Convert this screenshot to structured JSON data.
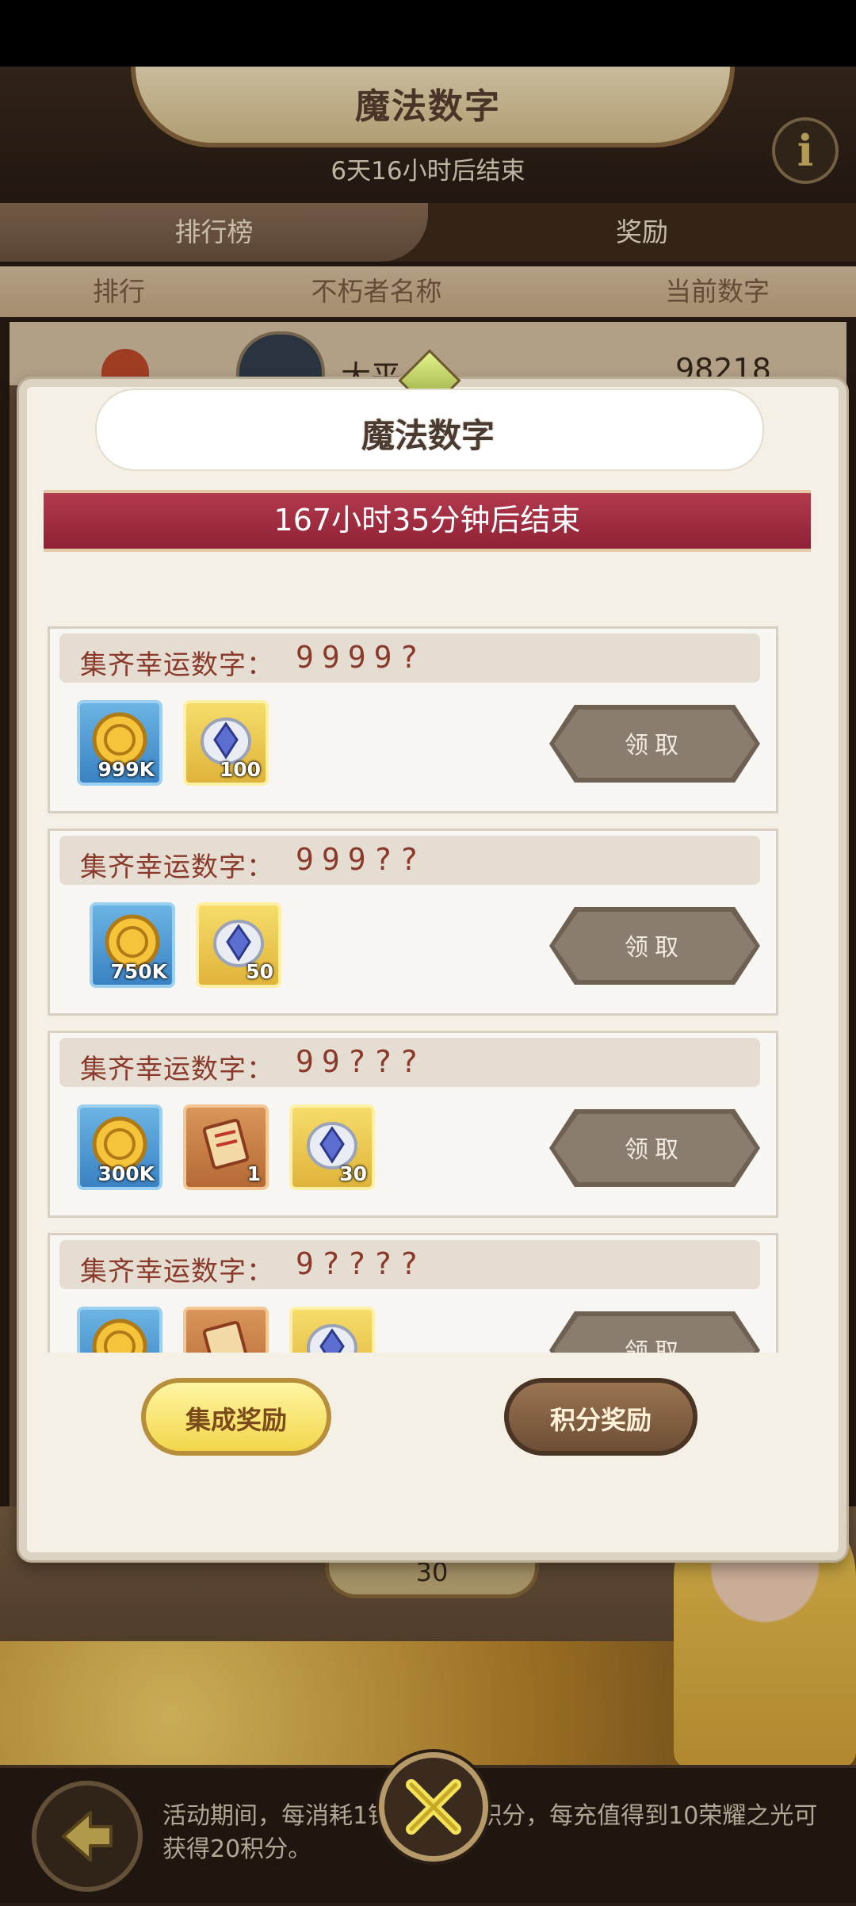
{
  "background": {
    "title": "魔法数字",
    "subtitle": "6天16小时后结束",
    "info_icon": "i",
    "tabs": [
      {
        "label": "排行榜",
        "active": true
      },
      {
        "label": "奖励",
        "active": false
      }
    ],
    "columns": [
      "排行",
      "不朽者名称",
      "当前数字"
    ],
    "row1": {
      "name": "大平",
      "score": "98218"
    },
    "counter_value": "30",
    "footer_text": "活动期间，每消耗1钻石获得1积分，每充值得到10荣耀之光可获得20积分。"
  },
  "modal": {
    "title": "魔法数字",
    "timer": "167小时35分钟后结束",
    "cards": [
      {
        "label": "集齐幸运数字：",
        "digits": "9999?",
        "rewards": [
          {
            "icon": "gold-coin-icon",
            "count": "999K",
            "frame": "blue"
          },
          {
            "icon": "crystal-stone-icon",
            "count": "100",
            "frame": "gold"
          }
        ],
        "claim_label": "领取"
      },
      {
        "label": "集齐幸运数字：",
        "digits": "999??",
        "rewards": [
          {
            "icon": "gold-coin-icon",
            "count": "750K",
            "frame": "blue"
          },
          {
            "icon": "crystal-stone-icon",
            "count": "50",
            "frame": "gold"
          }
        ],
        "claim_label": "领取"
      },
      {
        "label": "集齐幸运数字：",
        "digits": "99???",
        "rewards": [
          {
            "icon": "gold-coin-icon",
            "count": "300K",
            "frame": "blue"
          },
          {
            "icon": "scroll-icon",
            "count": "1",
            "frame": "brown"
          },
          {
            "icon": "crystal-stone-icon",
            "count": "30",
            "frame": "gold"
          }
        ],
        "claim_label": "领取"
      },
      {
        "label": "集齐幸运数字：",
        "digits": "9????",
        "rewards": [
          {
            "icon": "gold-coin-icon",
            "count": "",
            "frame": "blue"
          },
          {
            "icon": "scroll-icon",
            "count": "",
            "frame": "brown"
          },
          {
            "icon": "crystal-stone-icon",
            "count": "",
            "frame": "gold"
          }
        ],
        "claim_label": "领取"
      }
    ],
    "buttons": {
      "collect": "集成奖励",
      "points": "积分奖励"
    }
  },
  "colors": {
    "timer_band": "#a32b40",
    "claim_button": "#7a6d60",
    "collect_button": "#f2d64a",
    "points_button": "#7d5b3f"
  }
}
